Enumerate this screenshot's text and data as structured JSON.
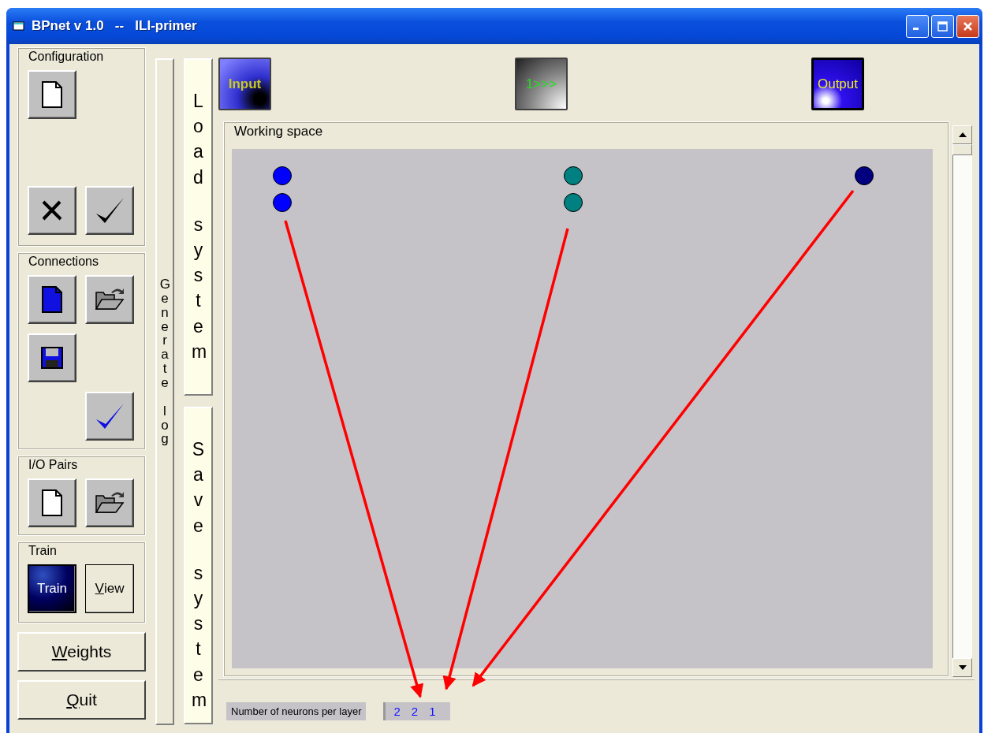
{
  "window": {
    "title": "BPnet v 1.0   --   ILI-primer"
  },
  "sidebar": {
    "groups": [
      {
        "title": "Configuration",
        "buttons": [
          {
            "kind": "new"
          },
          {
            "kind": "spacer"
          },
          {
            "kind": "cancel"
          },
          {
            "kind": "ok"
          }
        ]
      },
      {
        "title": "Connections",
        "buttons": [
          {
            "kind": "new-blue"
          },
          {
            "kind": "open"
          },
          {
            "kind": "save"
          },
          {
            "kind": "spacer"
          },
          {
            "kind": "spacer"
          },
          {
            "kind": "ok-blue"
          }
        ]
      },
      {
        "title": "I/O Pairs",
        "buttons": [
          {
            "kind": "new"
          },
          {
            "kind": "open"
          }
        ]
      },
      {
        "title": "Train",
        "buttons": [
          {
            "kind": "train",
            "label": "Train"
          },
          {
            "kind": "text",
            "accel": "V",
            "rest": "iew"
          }
        ]
      }
    ],
    "actions": [
      {
        "accel": "W",
        "rest": "eights"
      },
      {
        "accel": "Q",
        "rest": "uit"
      }
    ]
  },
  "generate_log": "Generate  log",
  "system_buttons": [
    "Load  system",
    "Save  system"
  ],
  "layer_buttons": [
    {
      "label": "Input",
      "kind": "input"
    },
    {
      "label": "1>>>",
      "kind": "hidden"
    },
    {
      "label": "Output",
      "kind": "output"
    }
  ],
  "working_space": {
    "title": "Working space",
    "layers": [
      {
        "neurons": [
          {
            "color": "#0000ff"
          },
          {
            "color": "#0000ff"
          }
        ]
      },
      {
        "neurons": [
          {
            "color": "#008080"
          },
          {
            "color": "#008080"
          }
        ]
      },
      {
        "neurons": [
          {
            "color": "#000080"
          }
        ]
      }
    ]
  },
  "status": {
    "label": "Number of neurons per layer",
    "counts": [
      "2",
      "2",
      "1"
    ]
  },
  "annotations": [
    {
      "kind": "arrow",
      "color": "#ff0000"
    },
    {
      "kind": "arrow",
      "color": "#ff0000"
    },
    {
      "kind": "arrow",
      "color": "#ff0000"
    }
  ]
}
